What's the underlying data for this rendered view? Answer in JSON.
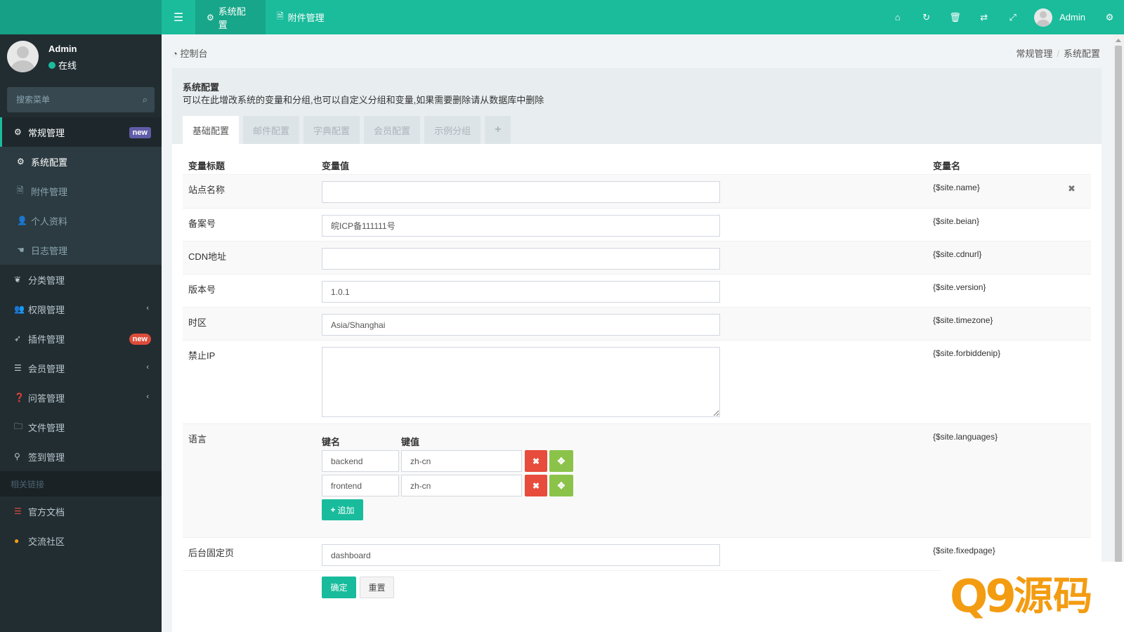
{
  "topbar": {
    "menu_icon": "bars-icon",
    "tabs": [
      {
        "label": "系统配置",
        "icon": "gear-icon",
        "active": true
      },
      {
        "label": "附件管理",
        "icon": "file-image-icon",
        "active": false
      }
    ],
    "right_icons": [
      "home-icon",
      "refresh-icon",
      "trash-icon",
      "translate-icon",
      "fullscreen-icon"
    ],
    "user_name": "Admin",
    "settings_icon": "cogs-icon",
    "color": "#1abc9c"
  },
  "sidebar": {
    "user_name": "Admin",
    "status": "在线",
    "search_placeholder": "搜索菜单",
    "menu": [
      {
        "label": "常规管理",
        "icon": "cogs-icon",
        "badge": "new",
        "active": true
      },
      {
        "label": "系统配置",
        "icon": "gear-icon",
        "active": true
      },
      {
        "label": "附件管理",
        "icon": "file-image-icon"
      },
      {
        "label": "个人资料",
        "icon": "user-icon"
      },
      {
        "label": "日志管理",
        "icon": "hand-pointer-icon"
      },
      {
        "label": "分类管理",
        "icon": "leaf-icon"
      },
      {
        "label": "权限管理",
        "icon": "group-icon"
      },
      {
        "label": "插件管理",
        "icon": "rocket-icon",
        "badge": "new"
      },
      {
        "label": "会员管理",
        "icon": "list-icon"
      },
      {
        "label": "问答管理",
        "icon": "question-icon"
      },
      {
        "label": "文件管理",
        "icon": "folder-icon"
      },
      {
        "label": "签到管理",
        "icon": "map-marker-icon"
      }
    ],
    "links_header": "相关链接",
    "links": [
      {
        "label": "官方文档",
        "icon": "list-alt-icon",
        "color": "#dd4b39"
      },
      {
        "label": "交流社区",
        "icon": "comment-icon",
        "color": "#f39c12"
      }
    ]
  },
  "breadcrumb": {
    "left": "控制台",
    "items": [
      "常规管理",
      "系统配置"
    ]
  },
  "panel": {
    "title": "系统配置",
    "description": "可以在此增改系统的变量和分组,也可以自定义分组和变量,如果需要删除请从数据库中删除",
    "tabs": [
      "基础配置",
      "邮件配置",
      "字典配置",
      "会员配置",
      "示例分组",
      "+"
    ],
    "columns": [
      "变量标题",
      "变量值",
      "变量名"
    ],
    "rows": [
      {
        "title": "站点名称",
        "value": "",
        "var": "{$site.name}"
      },
      {
        "title": "备案号",
        "value": "皖ICP备111111号",
        "var": "{$site.beian}"
      },
      {
        "title": "CDN地址",
        "value": "",
        "var": "{$site.cdnurl}"
      },
      {
        "title": "版本号",
        "value": "1.0.1",
        "var": "{$site.version}"
      },
      {
        "title": "时区",
        "value": "Asia/Shanghai",
        "var": "{$site.timezone}"
      },
      {
        "title": "禁止IP",
        "value": "",
        "var": "{$site.forbiddenip}"
      },
      {
        "title": "语言",
        "var": "{$site.languages}",
        "kv_key_label": "键名",
        "kv_val_label": "键值",
        "pairs": [
          {
            "key": "backend",
            "value": "zh-cn"
          },
          {
            "key": "frontend",
            "value": "zh-cn"
          }
        ],
        "add_label": "追加"
      },
      {
        "title": "后台固定页",
        "value": "dashboard",
        "var": "{$site.fixedpage}"
      }
    ],
    "submit_label": "确定",
    "reset_label": "重置"
  },
  "watermark": {
    "q": "Q9",
    "text": "源码",
    "color": "#f39c12"
  }
}
